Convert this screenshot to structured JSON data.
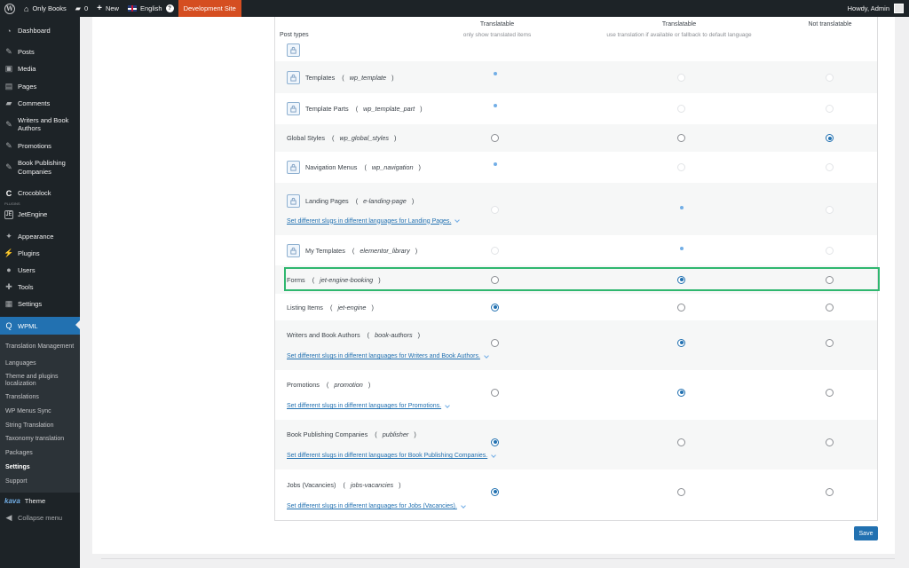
{
  "adminbar": {
    "site_name": "Only Books",
    "comments_count": "0",
    "new_label": "New",
    "language": "English",
    "help": "?",
    "dev_site": "Development Site",
    "howdy": "Howdy, Admin"
  },
  "sidebar": {
    "items": [
      {
        "label": "Dashboard",
        "icon": "dashboard-icon"
      },
      {
        "label": "Posts",
        "icon": "pin-icon"
      },
      {
        "label": "Media",
        "icon": "media-icon"
      },
      {
        "label": "Pages",
        "icon": "pages-icon"
      },
      {
        "label": "Comments",
        "icon": "comment-icon"
      },
      {
        "label": "Writers and Book Authors",
        "icon": "pin-icon"
      },
      {
        "label": "Promotions",
        "icon": "pin-icon"
      },
      {
        "label": "Book Publishing Companies",
        "icon": "pin-icon"
      },
      {
        "label": "Crocoblock",
        "icon": "crocoblock-icon"
      },
      {
        "label": "JetEngine",
        "icon": "jetengine-icon",
        "caption": "PLUGINS"
      },
      {
        "label": "Appearance",
        "icon": "brush-icon"
      },
      {
        "label": "Plugins",
        "icon": "plug-icon"
      },
      {
        "label": "Users",
        "icon": "user-icon"
      },
      {
        "label": "Tools",
        "icon": "wrench-icon"
      },
      {
        "label": "Settings",
        "icon": "settings-icon"
      },
      {
        "label": "WPML",
        "icon": "wpml-icon"
      }
    ],
    "wpml_sub": [
      "Translation Management",
      "Languages",
      "Theme and plugins localization",
      "Translations",
      "WP Menus Sync",
      "String Translation",
      "Taxonomy translation",
      "Packages",
      "Settings",
      "Support"
    ],
    "theme_brand": "kava",
    "theme_label": "Theme",
    "collapse": "Collapse menu"
  },
  "table": {
    "col0": "Post types",
    "col1_title": "Translatable",
    "col1_sub": "only show translated items",
    "col2_title": "Translatable",
    "col2_sub": "use translation if available or fallback to default language",
    "col3_title": "Not translatable",
    "rows": [
      {
        "name": "Templates",
        "slug": "wp_template",
        "state": "locked-translatable"
      },
      {
        "name": "Template Parts",
        "slug": "wp_template_part",
        "state": "locked-translatable"
      },
      {
        "name": "Global Styles",
        "slug": "wp_global_styles",
        "state": "not-translatable"
      },
      {
        "name": "Navigation Menus",
        "slug": "wp_navigation",
        "state": "locked-translatable"
      },
      {
        "name": "Landing Pages",
        "slug": "e-landing-page",
        "state": "locked-fallback"
      },
      {
        "name": "My Templates",
        "slug": "elementor_library",
        "state": "locked-fallback"
      },
      {
        "name": "Forms",
        "slug": "jet-engine-booking",
        "state": "fallback"
      },
      {
        "name": "Listing Items",
        "slug": "jet-engine",
        "state": "translatable"
      },
      {
        "name": "Writers and Book Authors",
        "slug": "book-authors",
        "state": "fallback"
      },
      {
        "name": "Promotions",
        "slug": "promotion",
        "state": "fallback"
      },
      {
        "name": "Book Publishing Companies",
        "slug": "publisher",
        "state": "translatable"
      },
      {
        "name": "Jobs (Vacancies)",
        "slug": "jobs-vacancies",
        "state": "translatable"
      }
    ],
    "slug_links": {
      "landing": "Set different slugs in different languages for Landing Pages.",
      "writers": "Set different slugs in different languages for Writers and Book Authors.",
      "promotions": "Set different slugs in different languages for Promotions.",
      "publishers": "Set different slugs in different languages for Book Publishing Companies.",
      "jobs": "Set different slugs in different languages for Jobs (Vacancies)."
    }
  },
  "save_label": "Save",
  "colors": {
    "accent": "#2271b1",
    "admin_bg": "#1d2327",
    "dev_badge": "#d54e21",
    "highlight": "#2fb76f"
  }
}
